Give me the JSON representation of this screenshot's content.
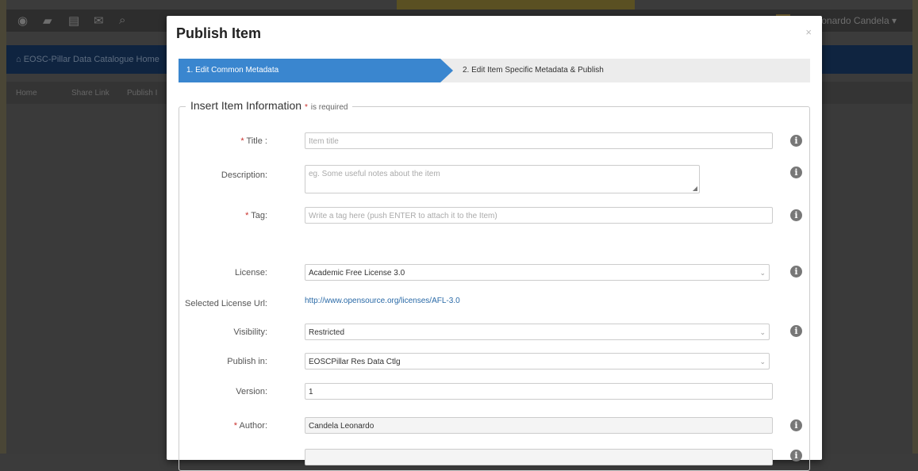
{
  "background": {
    "user_name": "eonardo Candela",
    "nav_home_label": "EOSC-Pillar Data Catalogue Home",
    "breadcrumb": [
      "Home",
      "Share Link",
      "Publish I"
    ]
  },
  "modal": {
    "title": "Publish Item",
    "close_symbol": "×",
    "wizard": {
      "steps": [
        {
          "label": "1.  Edit Common Metadata",
          "active": true
        },
        {
          "label": "2.  Edit Item Specific Metadata & Publish",
          "active": false
        }
      ]
    },
    "form": {
      "legend": "Insert Item Information",
      "required_marker": "*",
      "required_note": "is required",
      "fields": {
        "title": {
          "label": "Title :",
          "required": true,
          "value": "",
          "placeholder": "Item title"
        },
        "description": {
          "label": "Description:",
          "required": false,
          "value": "",
          "placeholder": "eg. Some useful notes about the item"
        },
        "tag": {
          "label": "Tag:",
          "required": true,
          "value": "",
          "placeholder": "Write a tag here (push ENTER to attach it to the Item)"
        },
        "license": {
          "label": "License:",
          "required": false,
          "value": "Academic Free License 3.0"
        },
        "license_url": {
          "label": "Selected License Url:",
          "value": "http://www.opensource.org/licenses/AFL-3.0"
        },
        "visibility": {
          "label": "Visibility:",
          "required": false,
          "value": "Restricted"
        },
        "publish_in": {
          "label": "Publish in:",
          "required": false,
          "value": "EOSCPillar Res Data Ctlg"
        },
        "version": {
          "label": "Version:",
          "required": false,
          "value": "1"
        },
        "author": {
          "label": "Author:",
          "required": true,
          "value": "Candela Leonardo"
        }
      }
    }
  },
  "icons": {
    "info": "info-icon",
    "close": "close-icon",
    "caret": "chevron-down-icon"
  }
}
